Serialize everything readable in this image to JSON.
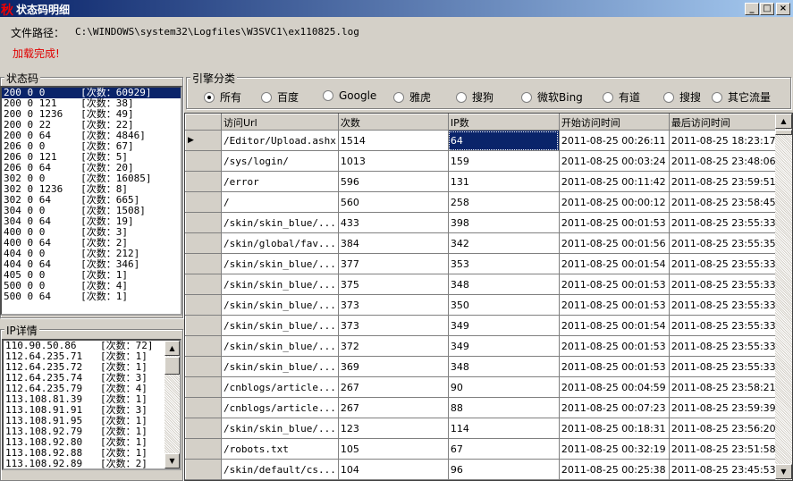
{
  "window": {
    "title": "状态码明细",
    "logo": "秋",
    "min": "_",
    "max": "□",
    "close": "×"
  },
  "file_path_label": "文件路径：",
  "file_path": "C:\\WINDOWS\\system32\\Logfiles\\W3SVC1\\ex110825.log",
  "status_message": "加载完成!",
  "status_group": {
    "label": "状态码",
    "items": [
      "200 0 0      [次数：60929]",
      "200 0 121    [次数：38]",
      "200 0 1236   [次数：49]",
      "200 0 22     [次数：22]",
      "200 0 64     [次数：4846]",
      "206 0 0      [次数：67]",
      "206 0 121    [次数：5]",
      "206 0 64     [次数：20]",
      "302 0 0      [次数：16085]",
      "302 0 1236   [次数：8]",
      "302 0 64     [次数：665]",
      "304 0 0      [次数：1508]",
      "304 0 64     [次数：19]",
      "400 0 0      [次数：3]",
      "400 0 64     [次数：2]",
      "404 0 0      [次数：212]",
      "404 0 64     [次数：346]",
      "405 0 0      [次数：1]",
      "500 0 0      [次数：4]",
      "500 0 64     [次数：1]"
    ]
  },
  "ip_group": {
    "label": "IP详情",
    "items": [
      "110.90.50.86    [次数：72]",
      "112.64.235.71   [次数：1]",
      "112.64.235.72   [次数：1]",
      "112.64.235.74   [次数：3]",
      "112.64.235.79   [次数：4]",
      "113.108.81.39   [次数：1]",
      "113.108.91.91   [次数：3]",
      "113.108.91.95   [次数：1]",
      "113.108.92.79   [次数：1]",
      "113.108.92.80   [次数：1]",
      "113.108.92.88   [次数：1]",
      "113.108.92.89   [次数：2]"
    ]
  },
  "engine_group": {
    "label": "引擎分类",
    "options": [
      "所有",
      "百度",
      "Google",
      "雅虎",
      "搜狗",
      "微软Bing",
      "有道",
      "搜搜",
      "其它流量"
    ],
    "selected": 0
  },
  "grid": {
    "columns": [
      "访问Url",
      "次数",
      "IP数",
      "开始访问时间",
      "最后访问时间"
    ],
    "rows": [
      [
        "/Editor/Upload.ashx",
        "1514",
        "64",
        "2011-08-25 00:26:11",
        "2011-08-25 18:23:17"
      ],
      [
        "/sys/login/",
        "1013",
        "159",
        "2011-08-25 00:03:24",
        "2011-08-25 23:48:06"
      ],
      [
        "/error",
        "596",
        "131",
        "2011-08-25 00:11:42",
        "2011-08-25 23:59:51"
      ],
      [
        "/",
        "560",
        "258",
        "2011-08-25 00:00:12",
        "2011-08-25 23:58:45"
      ],
      [
        "/skin/skin_blue/...",
        "433",
        "398",
        "2011-08-25 00:01:53",
        "2011-08-25 23:55:33"
      ],
      [
        "/skin/global/fav...",
        "384",
        "342",
        "2011-08-25 00:01:56",
        "2011-08-25 23:55:35"
      ],
      [
        "/skin/skin_blue/...",
        "377",
        "353",
        "2011-08-25 00:01:54",
        "2011-08-25 23:55:33"
      ],
      [
        "/skin/skin_blue/...",
        "375",
        "348",
        "2011-08-25 00:01:53",
        "2011-08-25 23:55:33"
      ],
      [
        "/skin/skin_blue/...",
        "373",
        "350",
        "2011-08-25 00:01:53",
        "2011-08-25 23:55:33"
      ],
      [
        "/skin/skin_blue/...",
        "373",
        "349",
        "2011-08-25 00:01:54",
        "2011-08-25 23:55:33"
      ],
      [
        "/skin/skin_blue/...",
        "372",
        "349",
        "2011-08-25 00:01:53",
        "2011-08-25 23:55:33"
      ],
      [
        "/skin/skin_blue/...",
        "369",
        "348",
        "2011-08-25 00:01:53",
        "2011-08-25 23:55:33"
      ],
      [
        "/cnblogs/article...",
        "267",
        "90",
        "2011-08-25 00:04:59",
        "2011-08-25 23:58:21"
      ],
      [
        "/cnblogs/article...",
        "267",
        "88",
        "2011-08-25 00:07:23",
        "2011-08-25 23:59:39"
      ],
      [
        "/skin/skin_blue/...",
        "123",
        "114",
        "2011-08-25 00:18:31",
        "2011-08-25 23:56:20"
      ],
      [
        "/robots.txt",
        "105",
        "67",
        "2011-08-25 00:32:19",
        "2011-08-25 23:51:58"
      ],
      [
        "/skin/default/cs...",
        "104",
        "96",
        "2011-08-25 00:25:38",
        "2011-08-25 23:45:53"
      ]
    ],
    "current_row_marker": "▶"
  },
  "colors": {
    "selection": "#0a246a",
    "status": "#e00000",
    "face": "#d4d0c8"
  }
}
